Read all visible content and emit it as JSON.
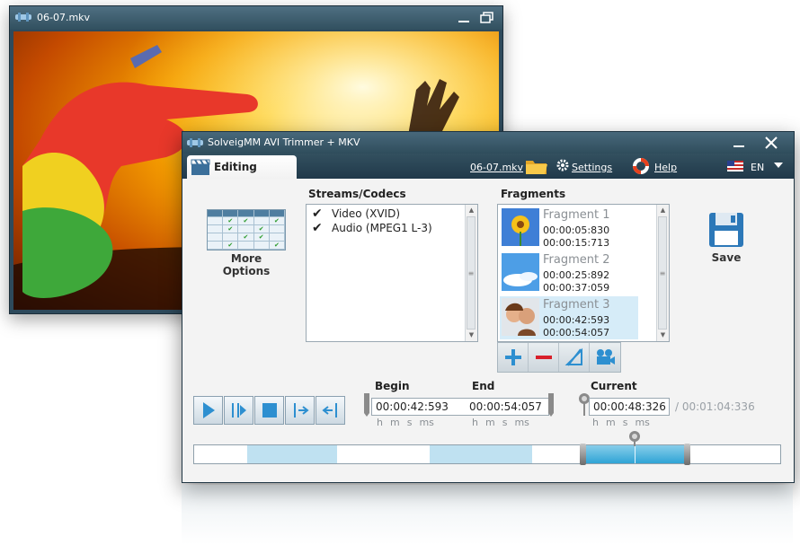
{
  "video_window": {
    "title": "06-07.mkv"
  },
  "main_window": {
    "title": "SolveigMM AVI Trimmer + MKV"
  },
  "toolbar": {
    "tab_editing": "Editing",
    "file_link": "06-07.mkv",
    "settings": "Settings",
    "help": "Help",
    "language": "EN"
  },
  "more_options": {
    "label": "More Options"
  },
  "streams": {
    "header": "Streams/Codecs",
    "items": [
      {
        "label": "Video (XVID)",
        "checked": true
      },
      {
        "label": "Audio (MPEG1 L-3)",
        "checked": true
      }
    ]
  },
  "fragments": {
    "header": "Fragments",
    "items": [
      {
        "name": "Fragment 1",
        "start": "00:00:05:830",
        "end": "00:00:15:713",
        "selected": false
      },
      {
        "name": "Fragment 2",
        "start": "00:00:25:892",
        "end": "00:00:37:059",
        "selected": false
      },
      {
        "name": "Fragment 3",
        "start": "00:00:42:593",
        "end": "00:00:54:057",
        "selected": true
      }
    ]
  },
  "save": {
    "label": "Save"
  },
  "times": {
    "begin_label": "Begin",
    "end_label": "End",
    "current_label": "Current",
    "begin": "00:00:42:593",
    "end": "00:00:54:057",
    "current": "00:00:48:326",
    "total": "/ 00:01:04:336",
    "units": [
      "h",
      "m",
      "s",
      "ms"
    ]
  },
  "timeline": {
    "duration_ms": 64336,
    "current_ms": 48326,
    "segments_ms": [
      [
        5830,
        15713
      ],
      [
        25892,
        37059
      ],
      [
        42593,
        54057
      ]
    ],
    "active_index": 2
  },
  "colors": {
    "title_bar": "#31505f",
    "segment": "#bfe1f1",
    "active_segment": "#2fa4d6",
    "accent_blue": "#2d8fd0",
    "minus_red": "#d8202a"
  }
}
